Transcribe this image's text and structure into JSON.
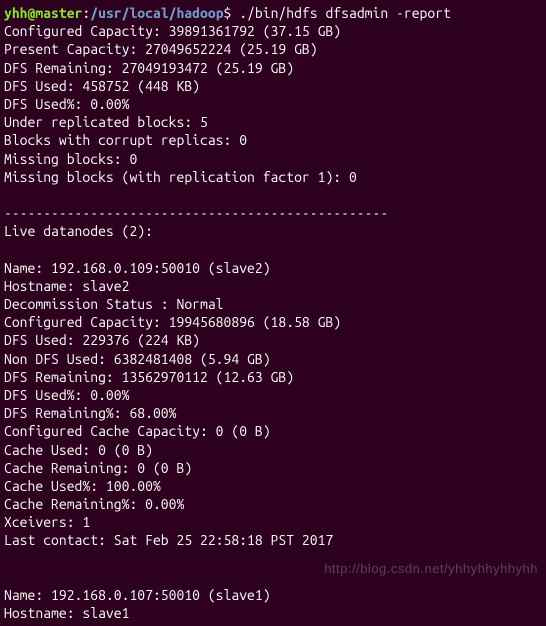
{
  "prompt": {
    "user": "yhh",
    "at": "@",
    "host": "master",
    "colon": ":",
    "path": "/usr/local/hadoop",
    "dollar": "$",
    "command": " ./bin/hdfs dfsadmin -report"
  },
  "summary": {
    "configured_capacity": "Configured Capacity: 39891361792 (37.15 GB)",
    "present_capacity": "Present Capacity: 27049652224 (25.19 GB)",
    "dfs_remaining": "DFS Remaining: 27049193472 (25.19 GB)",
    "dfs_used": "DFS Used: 458752 (448 KB)",
    "dfs_used_pct": "DFS Used%: 0.00%",
    "under_replicated": "Under replicated blocks: 5",
    "corrupt_replicas": "Blocks with corrupt replicas: 0",
    "missing_blocks": "Missing blocks: 0",
    "missing_rf1": "Missing blocks (with replication factor 1): 0"
  },
  "divider": "-------------------------------------------------",
  "live_header": "Live datanodes (2):",
  "node1": {
    "name": "Name: 192.168.0.109:50010 (slave2)",
    "hostname": "Hostname: slave2",
    "decommission": "Decommission Status : Normal",
    "configured_capacity": "Configured Capacity: 19945680896 (18.58 GB)",
    "dfs_used": "DFS Used: 229376 (224 KB)",
    "non_dfs_used": "Non DFS Used: 6382481408 (5.94 GB)",
    "dfs_remaining": "DFS Remaining: 13562970112 (12.63 GB)",
    "dfs_used_pct": "DFS Used%: 0.00%",
    "dfs_remaining_pct": "DFS Remaining%: 68.00%",
    "cache_capacity": "Configured Cache Capacity: 0 (0 B)",
    "cache_used": "Cache Used: 0 (0 B)",
    "cache_remaining": "Cache Remaining: 0 (0 B)",
    "cache_used_pct": "Cache Used%: 100.00%",
    "cache_remaining_pct": "Cache Remaining%: 0.00%",
    "xceivers": "Xceivers: 1",
    "last_contact": "Last contact: Sat Feb 25 22:58:18 PST 2017"
  },
  "node2": {
    "name": "Name: 192.168.0.107:50010 (slave1)",
    "hostname": "Hostname: slave1"
  },
  "watermark": "http://blog.csdn.net/yhhyhhyhhyhh"
}
